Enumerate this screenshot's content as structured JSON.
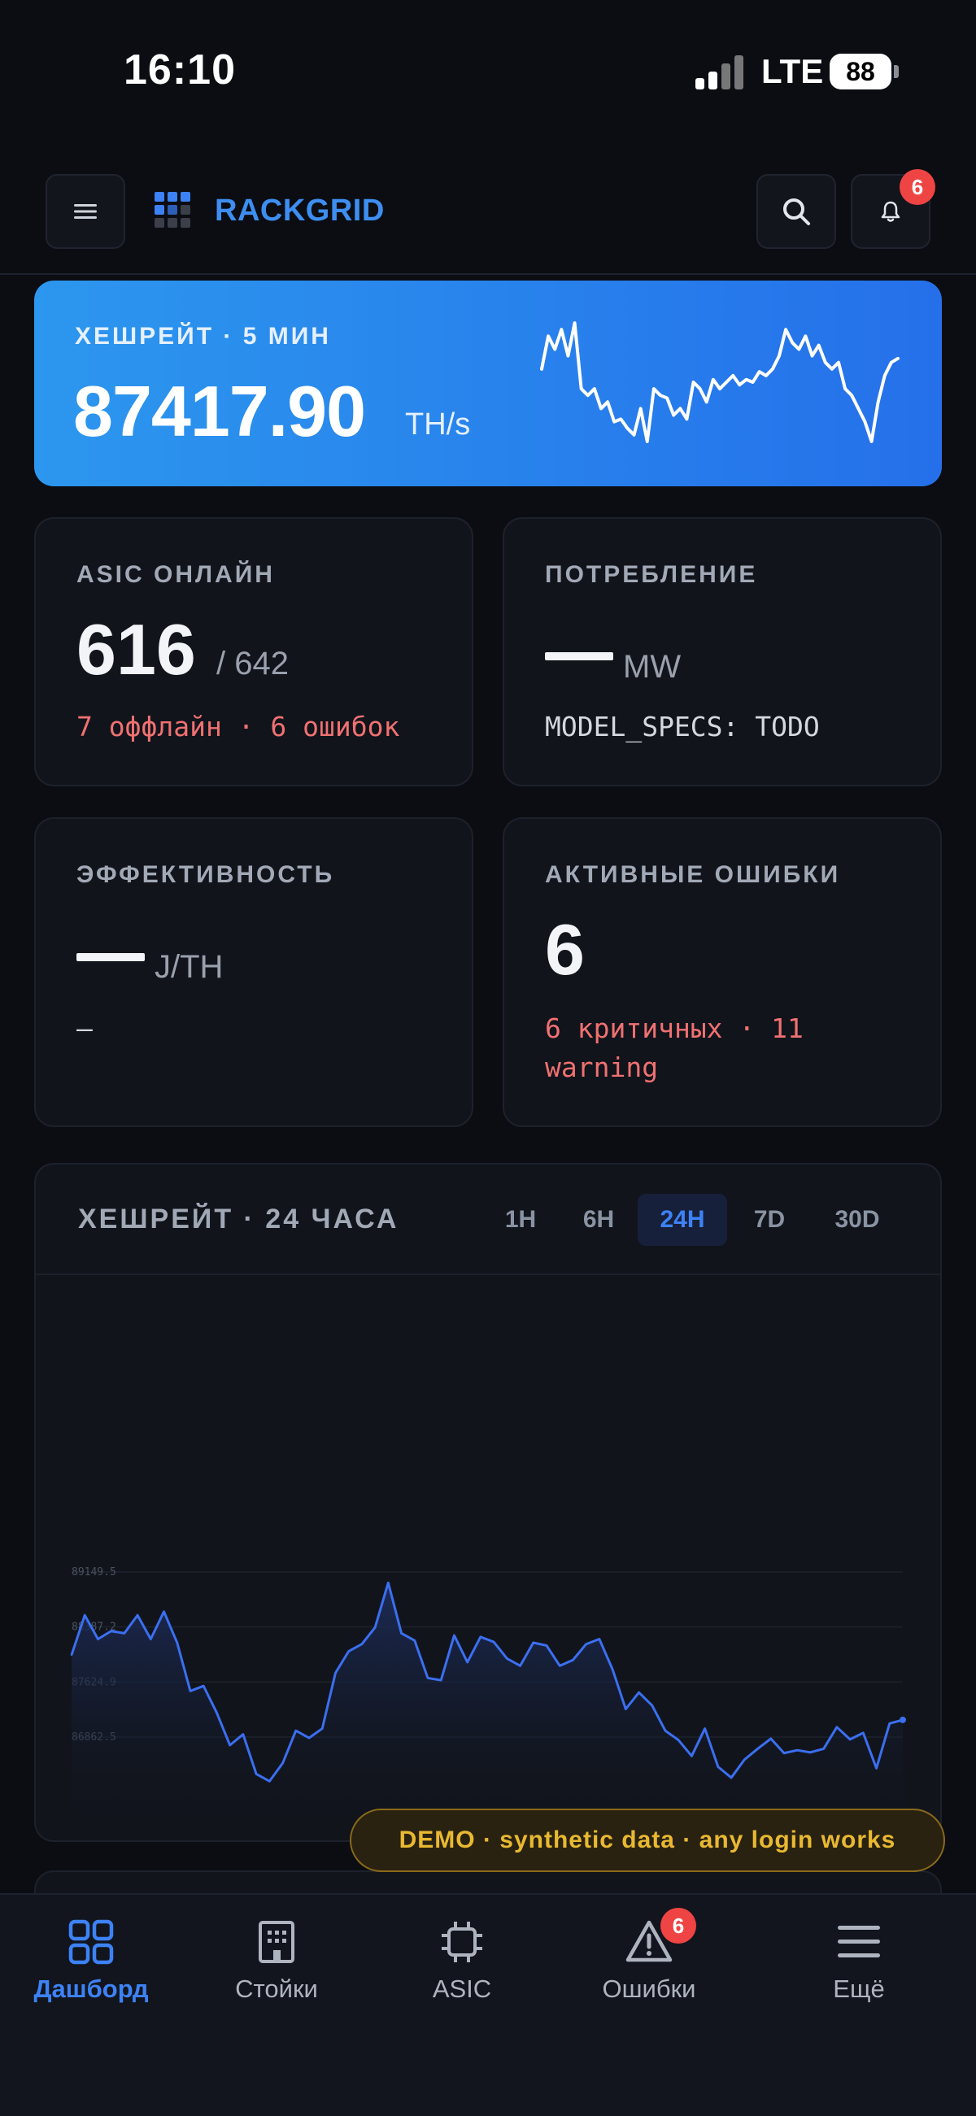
{
  "status_bar": {
    "time": "16:10",
    "network": "LTE",
    "battery": "88"
  },
  "header": {
    "brand": "RACKGRID",
    "notifications_count": "6",
    "icons": {
      "menu": "hamburger-icon",
      "search": "search-icon",
      "bell": "bell-icon",
      "logo": "grid-logo"
    }
  },
  "hero": {
    "label": "ХЕШРЕЙТ · 5 МИН",
    "value": "87417.90",
    "unit": "TH/s",
    "sparkline": [
      0.4,
      0.15,
      0.25,
      0.1,
      0.3,
      0.05,
      0.55,
      0.6,
      0.55,
      0.7,
      0.65,
      0.8,
      0.78,
      0.85,
      0.9,
      0.7,
      0.95,
      0.55,
      0.6,
      0.62,
      0.75,
      0.7,
      0.78,
      0.5,
      0.55,
      0.65,
      0.48,
      0.55,
      0.5,
      0.45,
      0.52,
      0.48,
      0.5,
      0.42,
      0.45,
      0.4,
      0.3,
      0.1,
      0.2,
      0.25,
      0.15,
      0.3,
      0.22,
      0.35,
      0.4,
      0.35,
      0.55,
      0.6,
      0.7,
      0.8,
      0.95,
      0.65,
      0.45,
      0.35,
      0.32
    ]
  },
  "cards": {
    "asic": {
      "label": "ASIC ОНЛАЙН",
      "value": "616",
      "total": "/ 642",
      "note": "7 оффлайн · 6 ошибок"
    },
    "power": {
      "label": "ПОТРЕБЛЕНИЕ",
      "unit": "MW",
      "note": "MODEL_SPECS: TODO"
    },
    "efficiency": {
      "label": "ЭФФЕКТИВНОСТЬ",
      "unit": "J/TH",
      "note": "–"
    },
    "errors": {
      "label": "АКТИВНЫЕ ОШИБКИ",
      "value": "6",
      "note": "6 критичных · 11 warning"
    }
  },
  "chart_panel": {
    "title": "ХЕШРЕЙТ · 24 ЧАСА",
    "ranges": [
      "1H",
      "6H",
      "24H",
      "7D",
      "30D"
    ],
    "active_range": "24H"
  },
  "chart_data": {
    "type": "area",
    "title": "",
    "xlabel": "",
    "ylabel": "",
    "y_ticks": [
      "89149.5",
      "88387.2",
      "87624.9",
      "86862.5"
    ],
    "ylim": [
      86862.5,
      89149.5
    ],
    "series": [
      {
        "values": [
          88000,
          88550,
          88220,
          88330,
          88300,
          88550,
          88220,
          88600,
          88170,
          87500,
          87570,
          87200,
          86750,
          86900,
          86350,
          86250,
          86500,
          86950,
          86850,
          86980,
          87750,
          88050,
          88150,
          88380,
          89000,
          88300,
          88200,
          87680,
          87650,
          88270,
          87900,
          88250,
          88180,
          87950,
          87850,
          88170,
          88130,
          87850,
          87930,
          88150,
          88220,
          87800,
          87250,
          87480,
          87300,
          86950,
          86820,
          86600,
          86980,
          86450,
          86300,
          86550,
          86700,
          86840,
          86640,
          86680,
          86650,
          86700,
          87000,
          86830,
          86920,
          86430,
          87050,
          87100
        ]
      }
    ],
    "colors": {
      "line": "#3b6ff0",
      "fill_top": "#1d2d5c",
      "grid": "#1d222d"
    }
  },
  "demo_banner": "DEMO · synthetic data · any login works",
  "bottom_nav": {
    "items": [
      {
        "label": "Дашборд",
        "icon": "dashboard-icon",
        "active": true
      },
      {
        "label": "Стойки",
        "icon": "building-icon"
      },
      {
        "label": "ASIC",
        "icon": "chip-icon"
      },
      {
        "label": "Ошибки",
        "icon": "warning-icon",
        "badge": "6"
      },
      {
        "label": "Ещё",
        "icon": "menu-icon"
      }
    ]
  },
  "colors": {
    "accent": "#3d82f5",
    "danger": "#ef4444",
    "warning_text": "#f07171",
    "background": "#0b0d12",
    "card": "#11141b"
  }
}
